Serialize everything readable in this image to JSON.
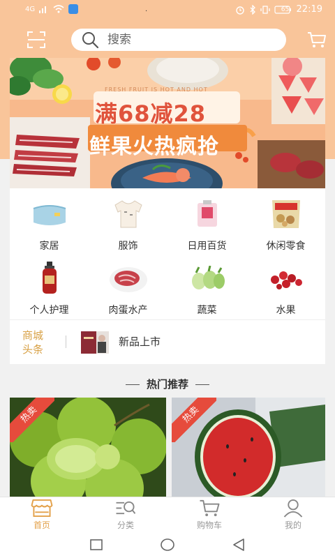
{
  "status_bar": {
    "signal": "4G",
    "dot": ".",
    "battery": "65",
    "time": "22:19"
  },
  "header": {
    "search_placeholder": "搜索",
    "icons": [
      "scan-icon",
      "search-icon",
      "cart-icon"
    ]
  },
  "banner": {
    "subtitle": "FRESH FRUIT IS HOT AND HOT",
    "title_line1": "满68减28",
    "title_line2": "鲜果火热疯抢"
  },
  "categories": [
    {
      "label": "家居",
      "icon": "towel-icon"
    },
    {
      "label": "服饰",
      "icon": "tshirt-icon"
    },
    {
      "label": "日用百货",
      "icon": "daily-goods-icon"
    },
    {
      "label": "休闲零食",
      "icon": "snack-icon"
    },
    {
      "label": "个人护理",
      "icon": "shampoo-icon"
    },
    {
      "label": "肉蛋水产",
      "icon": "meat-icon"
    },
    {
      "label": "蔬菜",
      "icon": "vegetable-icon"
    },
    {
      "label": "水果",
      "icon": "fruit-icon"
    }
  ],
  "news": {
    "tag_line1": "商城",
    "tag_line2": "头条",
    "text": "新品上市"
  },
  "section": {
    "title": "热门推荐"
  },
  "products": [
    {
      "tag": "热卖",
      "image": "green-grapes"
    },
    {
      "tag": "热卖",
      "image": "watermelon"
    }
  ],
  "bottom_nav": [
    {
      "label": "首页",
      "icon": "shop-icon",
      "active": true
    },
    {
      "label": "分类",
      "icon": "category-icon",
      "active": false
    },
    {
      "label": "购物车",
      "icon": "cart-icon",
      "active": false
    },
    {
      "label": "我的",
      "icon": "user-icon",
      "active": false
    }
  ],
  "colors": {
    "header_bg": "#f9c59a",
    "accent": "#e3a14a",
    "hot_tag": "#e64b3c",
    "banner_title": "#e0533c"
  }
}
